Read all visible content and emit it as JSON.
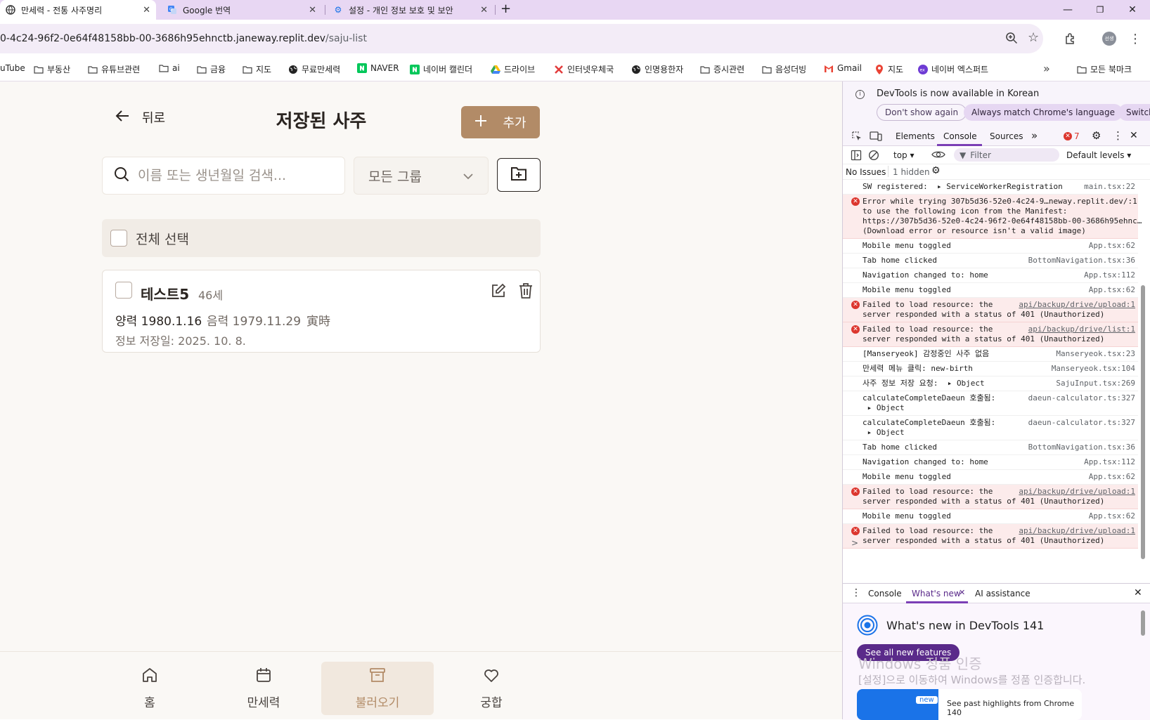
{
  "browser": {
    "tabs": [
      {
        "title": "만세력 - 전통 사주명리",
        "active": true
      },
      {
        "title": "Google 번역",
        "active": false
      },
      {
        "title": "설정 - 개인 정보 보호 및 보안",
        "active": false
      }
    ],
    "new_tab": "+",
    "window_controls": {
      "minimize": "—",
      "maximize": "❐",
      "close": "✕"
    },
    "url_host": "0-4c24-96f2-0e64f48158bb-00-3686h95ehnctb.janeway.replit.dev",
    "url_path": "/saju-list",
    "profile_label": "선생",
    "bookmarks": [
      {
        "label": "uTube",
        "icon": "youtube-icon"
      },
      {
        "label": "부동산",
        "icon": "folder-icon"
      },
      {
        "label": "유튜브관련",
        "icon": "folder-icon"
      },
      {
        "label": "ai",
        "icon": "folder-icon"
      },
      {
        "label": "금융",
        "icon": "folder-icon"
      },
      {
        "label": "지도",
        "icon": "folder-icon"
      },
      {
        "label": "무료만세력",
        "icon": "globe-icon"
      },
      {
        "label": "NAVER",
        "icon": "naver-icon"
      },
      {
        "label": "네이버 캘린더",
        "icon": "naver-icon"
      },
      {
        "label": "드라이브",
        "icon": "drive-icon"
      },
      {
        "label": "인터넷우체국",
        "icon": "post-icon"
      },
      {
        "label": "인명용한자",
        "icon": "globe-icon"
      },
      {
        "label": "증시관련",
        "icon": "folder-icon"
      },
      {
        "label": "음성더빙",
        "icon": "folder-icon"
      },
      {
        "label": "Gmail",
        "icon": "gmail-icon"
      },
      {
        "label": "지도",
        "icon": "maps-icon"
      },
      {
        "label": "네이버 엑스퍼트",
        "icon": "expert-icon"
      }
    ],
    "more_bookmarks": "»",
    "all_bookmarks": "모든 북마크"
  },
  "app": {
    "back_label": "뒤로",
    "title": "저장된 사주",
    "add_label": "추가",
    "search_placeholder": "이름 또는 생년월일 검색...",
    "group_select": "모든 그룹",
    "select_all": "전체 선택",
    "records": [
      {
        "name": "테스트5",
        "age": "46세",
        "solar": "양력 1980.1.16",
        "lunar": "음력 1979.11.29",
        "hour": "寅時",
        "saved": "정보 저장일: 2025. 10. 8."
      }
    ],
    "bottom_nav": [
      {
        "label": "홈",
        "icon": "home-icon",
        "active": false
      },
      {
        "label": "만세력",
        "icon": "calendar-icon",
        "active": false
      },
      {
        "label": "불러오기",
        "icon": "archive-icon",
        "active": true
      },
      {
        "label": "궁합",
        "icon": "heart-icon",
        "active": false
      }
    ],
    "colors": {
      "accent": "#b28b67",
      "background": "#faf8f5"
    }
  },
  "devtools": {
    "info_text": "DevTools is now available in Korean",
    "info_buttons": [
      "Don't show again",
      "Always match Chrome's language",
      "Switch"
    ],
    "tabs": [
      "Elements",
      "Console",
      "Sources"
    ],
    "active_tab": "Console",
    "error_count": "7",
    "context": "top",
    "filter_placeholder": "Filter",
    "levels": "Default levels",
    "issues": "No Issues",
    "hidden": "1 hidden",
    "logs": [
      {
        "type": "log",
        "text": "SW registered:  ▸ ServiceWorkerRegistration",
        "source": "main.tsx:22"
      },
      {
        "type": "error",
        "text": "Error while trying 307b5d36-52e0-4c24-9…neway.replit.dev/:1\nto use the following icon from the Manifest:\nhttps://307b5d36-52e0-4c24-96f2-0e64f48158bb-00-3686h95ehnc…\n(Download error or resource isn't a valid image)",
        "source": ""
      },
      {
        "type": "log",
        "text": "Mobile menu toggled",
        "source": "App.tsx:62"
      },
      {
        "type": "log",
        "text": "Tab home clicked",
        "source": "BottomNavigation.tsx:36"
      },
      {
        "type": "log",
        "text": "Navigation changed to: home",
        "source": "App.tsx:112"
      },
      {
        "type": "log",
        "text": "Mobile menu toggled",
        "source": "App.tsx:62"
      },
      {
        "type": "error",
        "text": "Failed to load resource: the\nserver responded with a status of 401 (Unauthorized)",
        "source": "api/backup/drive/upload:1"
      },
      {
        "type": "error",
        "text": "Failed to load resource: the\nserver responded with a status of 401 (Unauthorized)",
        "source": "api/backup/drive/list:1"
      },
      {
        "type": "log",
        "text": "[Manseryeok] 감정중인 사주 없음",
        "source": "Manseryeok.tsx:23"
      },
      {
        "type": "log",
        "text": "만세력 메뉴 클릭: new-birth",
        "source": "Manseryeok.tsx:104"
      },
      {
        "type": "log",
        "text": "사주 정보 저장 요청:  ▸ Object",
        "source": "SajuInput.tsx:269"
      },
      {
        "type": "log",
        "text": "calculateCompleteDaeun 호출됨:\n ▸ Object",
        "source": "daeun-calculator.ts:327"
      },
      {
        "type": "log",
        "text": "calculateCompleteDaeun 호출됨:\n ▸ Object",
        "source": "daeun-calculator.ts:327"
      },
      {
        "type": "log",
        "text": "Tab home clicked",
        "source": "BottomNavigation.tsx:36"
      },
      {
        "type": "log",
        "text": "Navigation changed to: home",
        "source": "App.tsx:112"
      },
      {
        "type": "log",
        "text": "Mobile menu toggled",
        "source": "App.tsx:62"
      },
      {
        "type": "error",
        "text": "Failed to load resource: the\nserver responded with a status of 401 (Unauthorized)",
        "source": "api/backup/drive/upload:1"
      },
      {
        "type": "log",
        "text": "Mobile menu toggled",
        "source": "App.tsx:62"
      },
      {
        "type": "error",
        "text": "Failed to load resource: the\nserver responded with a status of 401 (Unauthorized)",
        "source": "api/backup/drive/upload:1"
      }
    ],
    "prompt": ">",
    "drawer_tabs": [
      "Console",
      "What's new",
      "AI assistance"
    ],
    "whats_new_title": "What's new in DevTools 141",
    "see_all": "See all new features",
    "new_badge": "new",
    "highlights": "See past highlights from Chrome 140",
    "windows_title": "Windows 정품 인증",
    "windows_text": "[설정]으로 이동하여 Windows를 정품 인증합니다."
  }
}
